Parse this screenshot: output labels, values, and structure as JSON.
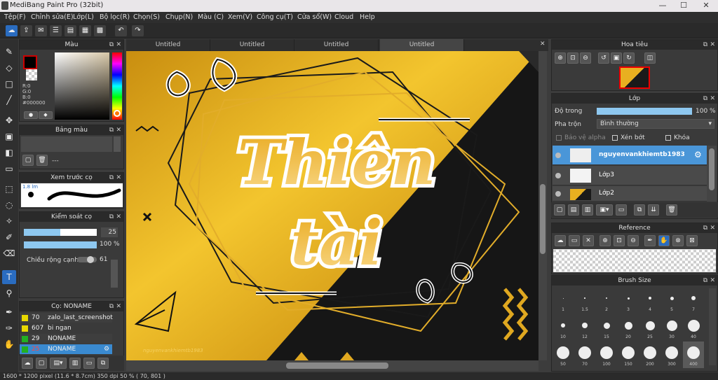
{
  "window": {
    "title": "MediBang Paint Pro (32bit)",
    "minimize": "—",
    "maximize": "☐",
    "close": "✕"
  },
  "menu": [
    "Tệp(F)",
    "Chỉnh sửa(E)",
    "Lớp(L)",
    "Bộ lọc(R)",
    "Chọn(S)",
    "Chụp(N)",
    "Màu (C)",
    "Xem(V)",
    "Công cụ(T)",
    "Cửa sổ(W)",
    "Cloud",
    "Help"
  ],
  "color_panel": {
    "title": "Màu",
    "r": "R:0",
    "g": "G:0",
    "b": "B:0",
    "hex": "#000000"
  },
  "palette": {
    "title": "Bảng màu",
    "dash": "---"
  },
  "brush_preview": {
    "title": "Xem trước cọ",
    "size": "1.8 lm"
  },
  "brush_control": {
    "title": "Kiểm soát cọ",
    "size_value": "25",
    "opacity_value": "100 %",
    "width_label": "Chiều rộng cạnh",
    "width_value": "61"
  },
  "brush_list": {
    "title": "Cọ: NONAME",
    "items": [
      {
        "num": "70",
        "label": "zalo_last_screenshot",
        "color": "#e8d800"
      },
      {
        "num": "607",
        "label": "bi ngan",
        "color": "#e8d800"
      },
      {
        "num": "29",
        "label": "NONAME",
        "color": "#22b022"
      },
      {
        "num": "25",
        "label": "NONAME",
        "color": "#22b022"
      }
    ]
  },
  "tabs": [
    "Untitled",
    "Untitled",
    "Untitled",
    "Untitled"
  ],
  "artwork": {
    "line1": "Thiên",
    "line2": "tài",
    "signature": "nguyenvankhiemtb1983"
  },
  "navigator": {
    "title": "Hoa tiêu"
  },
  "layers": {
    "title": "Lớp",
    "opacity_label": "Độ trong",
    "opacity_value": "100 %",
    "blend_label": "Pha trộn",
    "blend_value": "Bình thường",
    "protect_alpha": "Bảo vệ alpha",
    "clipping": "Xén bớt",
    "lock": "Khóa",
    "items": [
      "nguyenvankhiemtb1983",
      "Lớp3",
      "Lớp2"
    ]
  },
  "reference": {
    "title": "Reference"
  },
  "brush_size": {
    "title": "Brush Size",
    "sizes": [
      "1",
      "1.5",
      "2",
      "3",
      "4",
      "5",
      "7",
      "10",
      "12",
      "15",
      "20",
      "25",
      "30",
      "40",
      "50",
      "70",
      "100",
      "150",
      "200",
      "300",
      "400"
    ]
  },
  "status": {
    "text": "1600 * 1200 pixel   (11.6 * 8.7cm)   350 dpi   50 %   ( 70, 801 )"
  }
}
